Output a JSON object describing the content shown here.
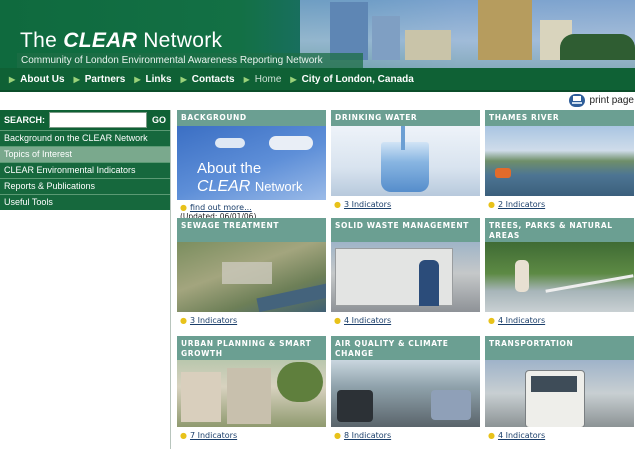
{
  "header": {
    "title_pre": "The",
    "title_bold": "CLEAR",
    "title_post": "Network",
    "subtitle": "Community of London Environmental Awareness Reporting Network"
  },
  "nav": [
    {
      "label": "About Us"
    },
    {
      "label": "Partners"
    },
    {
      "label": "Links"
    },
    {
      "label": "Contacts"
    },
    {
      "label": "Home"
    },
    {
      "label": "City of London, Canada"
    }
  ],
  "print": {
    "label": "print page"
  },
  "search": {
    "label": "SEARCH:",
    "placeholder": "",
    "go": "GO"
  },
  "sidebar": {
    "items": [
      {
        "label": "Background on the CLEAR Network"
      },
      {
        "label": "Topics of Interest"
      },
      {
        "label": "CLEAR Environmental Indicators"
      },
      {
        "label": "Reports & Publications"
      },
      {
        "label": "Useful Tools"
      }
    ]
  },
  "tiles": [
    {
      "title": "BACKGROUND",
      "img_text_1": "About the",
      "img_text_2": "CLEAR",
      "img_text_3": "Network",
      "link": "find out more...",
      "note": "(Updated: 06/01/06)"
    },
    {
      "title": "DRINKING WATER",
      "link": "3 Indicators"
    },
    {
      "title": "THAMES RIVER",
      "link": "2 Indicators"
    },
    {
      "title": "SEWAGE TREATMENT",
      "link": "3 Indicators"
    },
    {
      "title": "SOLID WASTE MANAGEMENT",
      "link": "4 Indicators"
    },
    {
      "title": "TREES, PARKS & NATURAL AREAS",
      "link": "4 Indicators"
    },
    {
      "title": "URBAN PLANNING & SMART GROWTH",
      "link": "7 Indicators"
    },
    {
      "title": "AIR QUALITY & CLIMATE CHANGE",
      "link": "8 Indicators"
    },
    {
      "title": "TRANSPORTATION",
      "link": "4 Indicators"
    }
  ],
  "colors": {
    "brand_green": "#0f6135",
    "tile_header": "#6b9f92",
    "link": "#1a3e6a"
  }
}
